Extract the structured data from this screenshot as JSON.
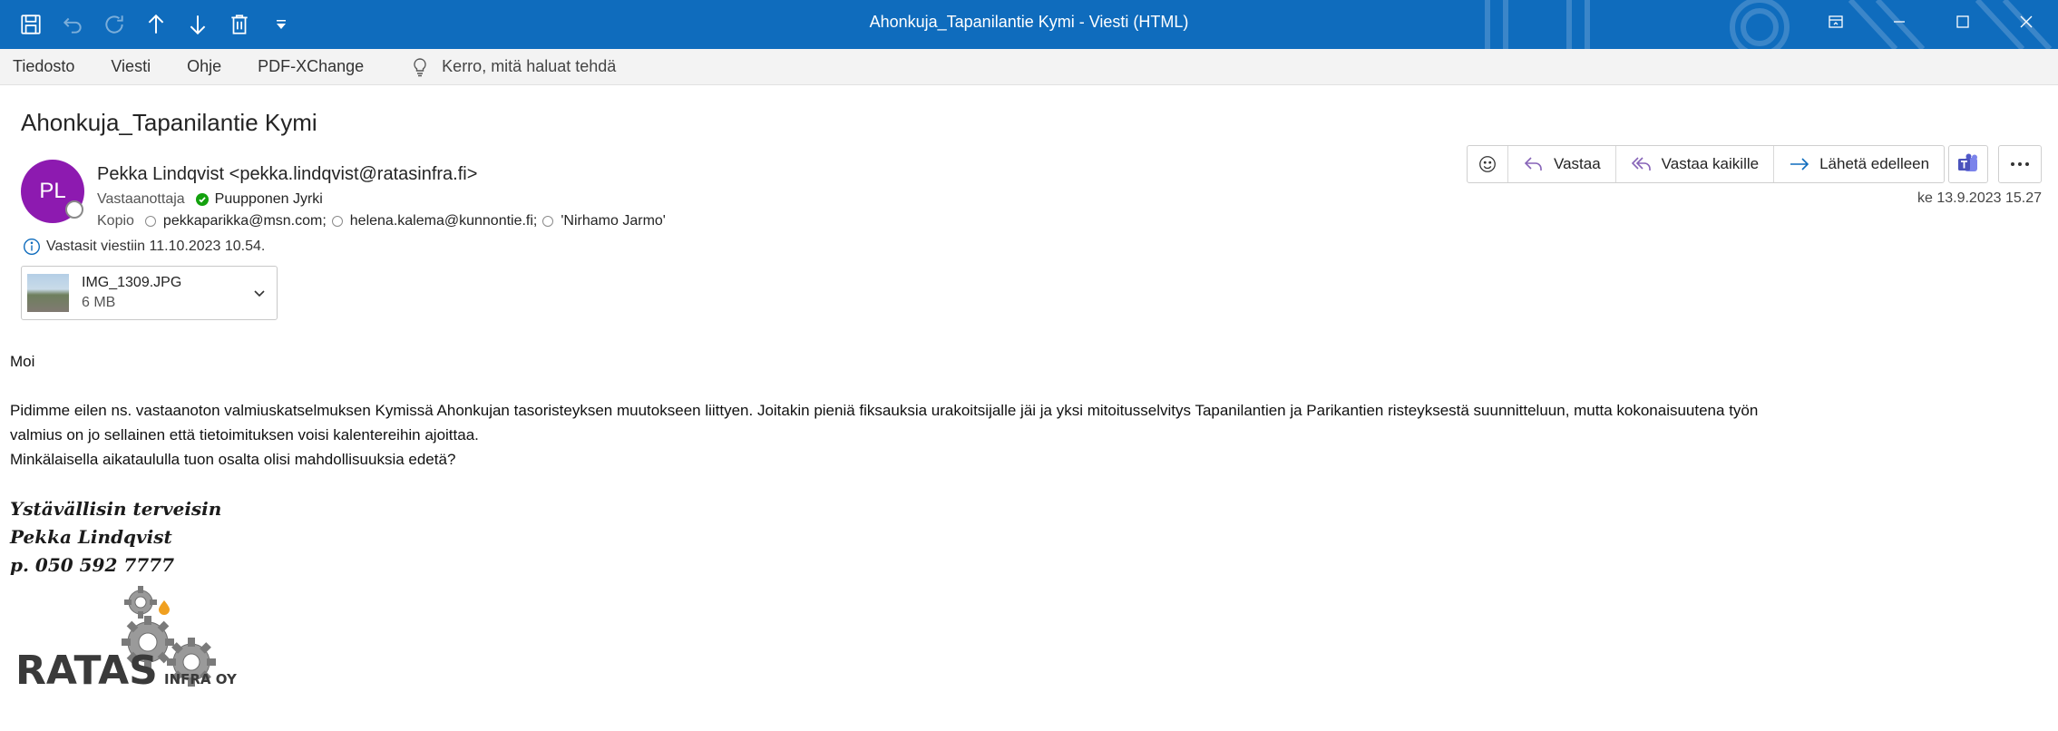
{
  "window": {
    "title": "Ahonkuja_Tapanilantie Kymi  -  Viesti (HTML)"
  },
  "menu": {
    "items": [
      "Tiedosto",
      "Viesti",
      "Ohje",
      "PDF-XChange"
    ],
    "tell_me": "Kerro, mitä haluat tehdä"
  },
  "message": {
    "subject": "Ahonkuja_Tapanilantie Kymi",
    "avatar_initials": "PL",
    "from": "Pekka Lindqvist <pekka.lindqvist@ratasinfra.fi>",
    "to_label": "Vastaanottaja",
    "to": [
      "Puupponen Jyrki"
    ],
    "cc_label": "Kopio",
    "cc": [
      "pekkaparikka@msn.com;",
      "helena.kalema@kunnontie.fi;",
      "'Nirhamo Jarmo'"
    ],
    "info": "Vastasit viestiin 11.10.2023 10.54.",
    "date": "ke 13.9.2023 15.27",
    "attachment": {
      "name": "IMG_1309.JPG",
      "size": "6 MB"
    }
  },
  "actions": {
    "reply": "Vastaa",
    "reply_all": "Vastaa kaikille",
    "forward": "Lähetä edelleen"
  },
  "body": {
    "greeting": "Moi",
    "paragraph1": "Pidimme eilen ns. vastaanoton valmiuskatselmuksen Kymissä Ahonkujan tasoristeyksen muutokseen liittyen. Joitakin pieniä fiksauksia urakoitsijalle jäi ja yksi mitoitusselvitys Tapanilantien ja Parikantien risteyksestä suunnitteluun, mutta kokonaisuutena työn",
    "paragraph1_cont": "valmius on jo sellainen että tietoimituksen voisi kalentereihin ajoittaa.",
    "paragraph2": "Minkälaisella aikataululla tuon osalta olisi mahdollisuuksia edetä?"
  },
  "signature": {
    "line1": "Ystävällisin terveisin",
    "line2": "Pekka Lindqvist",
    "line3": "p. 050 592 7777",
    "logo_text": "RATAS",
    "logo_sub": "INFRA OY"
  },
  "colors": {
    "titlebar": "#0f6cbd",
    "avatar": "#8d1ab0",
    "accent_reply": "#8764b8",
    "accent_forward": "#0f6cbd",
    "presence_ok": "#13a10e"
  }
}
